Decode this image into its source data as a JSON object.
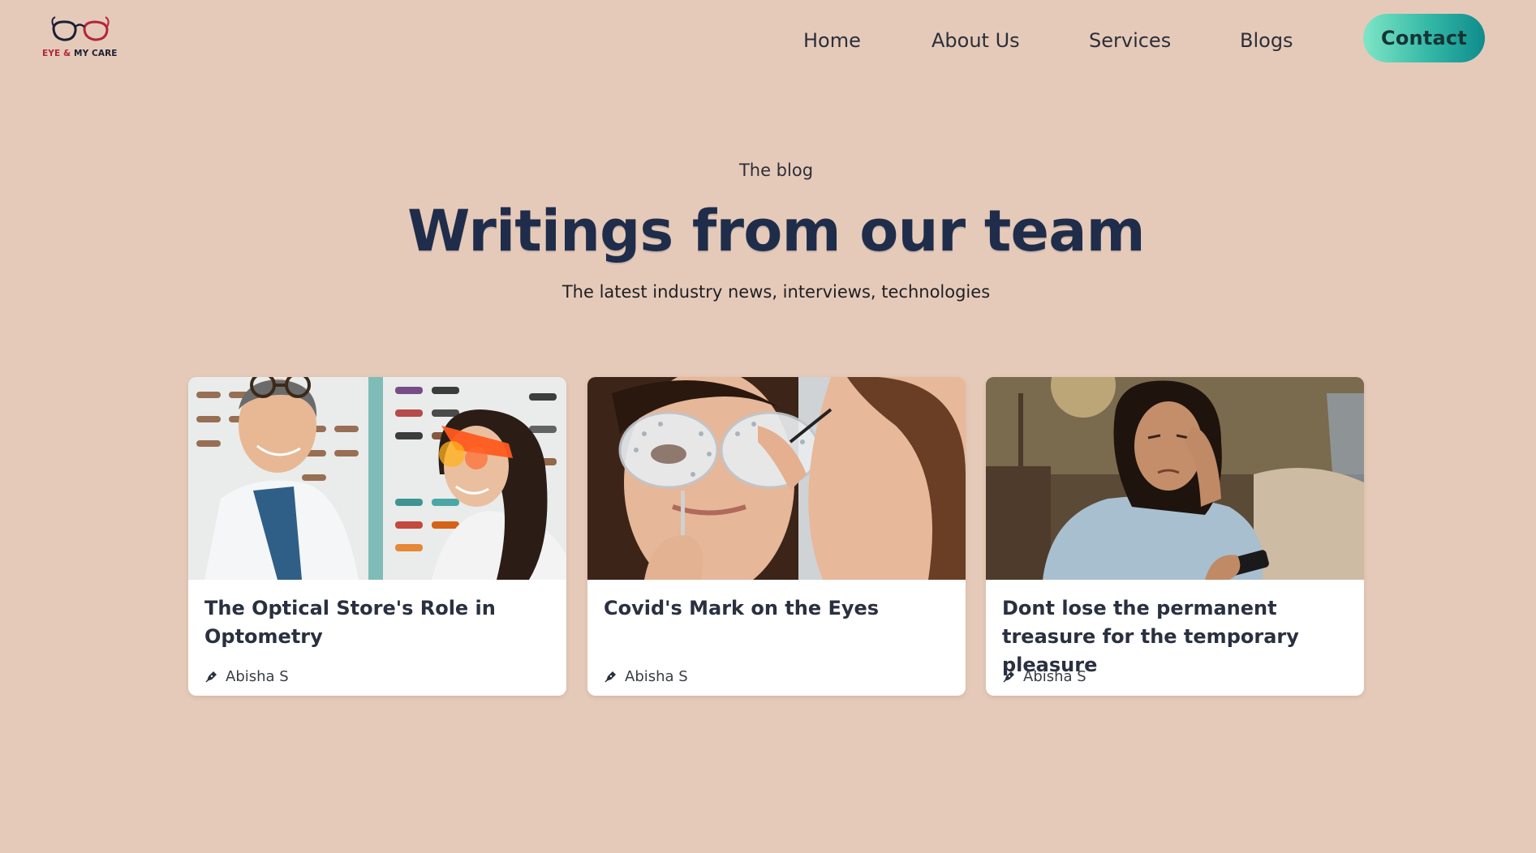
{
  "brand": {
    "logo_text_part1": "EYE &",
    "logo_text_part2": "MY CARE",
    "logo_icon": "glasses-logo",
    "colors": {
      "accent_red": "#b3263a",
      "dark_navy": "#1b2033"
    }
  },
  "nav": {
    "items": [
      {
        "label": "Home"
      },
      {
        "label": "About Us"
      },
      {
        "label": "Services"
      },
      {
        "label": "Blogs"
      }
    ],
    "contact_label": "Contact"
  },
  "hero": {
    "eyebrow": "The blog",
    "title": "Writings from our team",
    "subtitle": "The latest industry news, interviews, technologies"
  },
  "posts": [
    {
      "title": "The Optical Store's Role in Optometry",
      "author": "Abisha S",
      "author_icon": "pen-icon",
      "image": "optician-fitting-glasses-photo"
    },
    {
      "title": "Covid's Mark on the Eyes",
      "author": "Abisha S",
      "author_icon": "pen-icon",
      "image": "eye-exam-trial-frame-photo"
    },
    {
      "title": "Dont lose the permanent treasure for the temporary pleasure",
      "author": "Abisha S",
      "author_icon": "pen-icon",
      "image": "tired-woman-with-phone-photo"
    }
  ],
  "theme": {
    "background": "#e6cab9",
    "heading_color": "#1f2d4a",
    "contact_gradient_start": "#7ee6c6",
    "contact_gradient_end": "#0f8c8c"
  }
}
